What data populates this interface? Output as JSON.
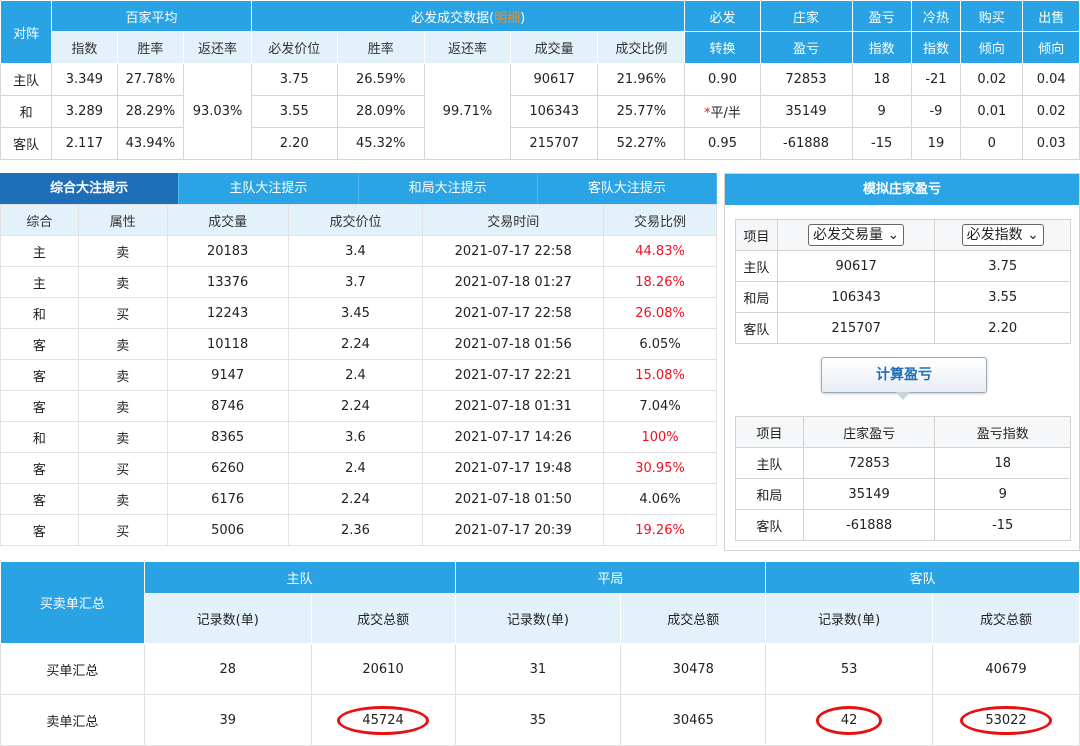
{
  "top": {
    "h_vs": "对阵",
    "h_avg": "百家平均",
    "h_bf": "必发成交数据(",
    "h_bf_link": "明细",
    "h_bf_end": ")",
    "h_conv1": "必发",
    "h_conv2": "转换",
    "h_dealer1": "庄家",
    "h_dealer2": "盈亏",
    "h_pl1": "盈亏",
    "h_pl2": "指数",
    "h_hc1": "冷热",
    "h_hc2": "指数",
    "h_buy1": "购买",
    "h_buy2": "倾向",
    "h_sell1": "出售",
    "h_sell2": "倾向",
    "sub": [
      "指数",
      "胜率",
      "返还率",
      "必发价位",
      "胜率",
      "返还率",
      "成交量",
      "成交比例"
    ],
    "ret1": "93.03%",
    "ret2": "99.71%",
    "rows": [
      {
        "team": "主队",
        "idx": "3.349",
        "win": "27.78%",
        "price": "3.75",
        "bwin": "26.59%",
        "vol": "90617",
        "ratio": "21.96%",
        "conv": "0.90",
        "dealer": "72853",
        "pl": "18",
        "hc": "-21",
        "buy": "0.02",
        "sell": "0.04"
      },
      {
        "team": "和",
        "idx": "3.289",
        "win": "28.29%",
        "price": "3.55",
        "bwin": "28.09%",
        "vol": "106343",
        "ratio": "25.77%",
        "conv": "*平/半",
        "dealer": "35149",
        "pl": "9",
        "hc": "-9",
        "buy": "0.01",
        "sell": "0.02"
      },
      {
        "team": "客队",
        "idx": "2.117",
        "win": "43.94%",
        "price": "2.20",
        "bwin": "45.32%",
        "vol": "215707",
        "ratio": "52.27%",
        "conv": "0.95",
        "dealer": "-61888",
        "pl": "-15",
        "hc": "19",
        "buy": "0",
        "sell": "0.03"
      }
    ]
  },
  "tabs": [
    "综合大注提示",
    "主队大注提示",
    "和局大注提示",
    "客队大注提示"
  ],
  "bets": {
    "headers": [
      "综合",
      "属性",
      "成交量",
      "成交价位",
      "交易时间",
      "交易比例"
    ],
    "rows": [
      {
        "t": "主",
        "a": "卖",
        "v": "20183",
        "p": "3.4",
        "time": "2021-07-17 22:58",
        "r": "44.83%",
        "red": true
      },
      {
        "t": "主",
        "a": "卖",
        "v": "13376",
        "p": "3.7",
        "time": "2021-07-18 01:27",
        "r": "18.26%",
        "red": true
      },
      {
        "t": "和",
        "a": "买",
        "v": "12243",
        "p": "3.45",
        "time": "2021-07-17 22:58",
        "r": "26.08%",
        "red": true
      },
      {
        "t": "客",
        "a": "卖",
        "v": "10118",
        "p": "2.24",
        "time": "2021-07-18 01:56",
        "r": "6.05%",
        "red": false
      },
      {
        "t": "客",
        "a": "卖",
        "v": "9147",
        "p": "2.4",
        "time": "2021-07-17 22:21",
        "r": "15.08%",
        "red": true
      },
      {
        "t": "客",
        "a": "卖",
        "v": "8746",
        "p": "2.24",
        "time": "2021-07-18 01:31",
        "r": "7.04%",
        "red": false
      },
      {
        "t": "和",
        "a": "卖",
        "v": "8365",
        "p": "3.6",
        "time": "2021-07-17 14:26",
        "r": "100%",
        "red": true
      },
      {
        "t": "客",
        "a": "买",
        "v": "6260",
        "p": "2.4",
        "time": "2021-07-17 19:48",
        "r": "30.95%",
        "red": true
      },
      {
        "t": "客",
        "a": "卖",
        "v": "6176",
        "p": "2.24",
        "time": "2021-07-18 01:50",
        "r": "4.06%",
        "red": false
      },
      {
        "t": "客",
        "a": "买",
        "v": "5006",
        "p": "2.36",
        "time": "2021-07-17 20:39",
        "r": "19.26%",
        "red": true
      }
    ]
  },
  "sim": {
    "title": "模拟庄家盈亏",
    "item": "项目",
    "sel1": "必发交易量",
    "sel2": "必发指数",
    "rows": [
      {
        "n": "主队",
        "v": "90617",
        "i": "3.75"
      },
      {
        "n": "和局",
        "v": "106343",
        "i": "3.55"
      },
      {
        "n": "客队",
        "v": "215707",
        "i": "2.20"
      }
    ],
    "calc": "计算盈亏",
    "res_headers": [
      "项目",
      "庄家盈亏",
      "盈亏指数"
    ],
    "res_rows": [
      {
        "n": "主队",
        "v": "72853",
        "i": "18"
      },
      {
        "n": "和局",
        "v": "35149",
        "i": "9"
      },
      {
        "n": "客队",
        "v": "-61888",
        "i": "-15"
      }
    ]
  },
  "summary": {
    "corner": "买卖单汇总",
    "groups": [
      "主队",
      "平局",
      "客队"
    ],
    "sub": [
      "记录数(单)",
      "成交总额",
      "记录数(单)",
      "成交总额",
      "记录数(单)",
      "成交总额"
    ],
    "rows": [
      {
        "label": "买单汇总",
        "vals": [
          "28",
          "20610",
          "31",
          "30478",
          "53",
          "40679"
        ]
      },
      {
        "label": "卖单汇总",
        "vals": [
          "39",
          "45724",
          "35",
          "30465",
          "42",
          "53022"
        ]
      }
    ]
  },
  "colors": {
    "accent": "#29a3e3",
    "tab_active": "#1e6fb8",
    "red": "#e81010",
    "orange": "#f08b1e"
  }
}
